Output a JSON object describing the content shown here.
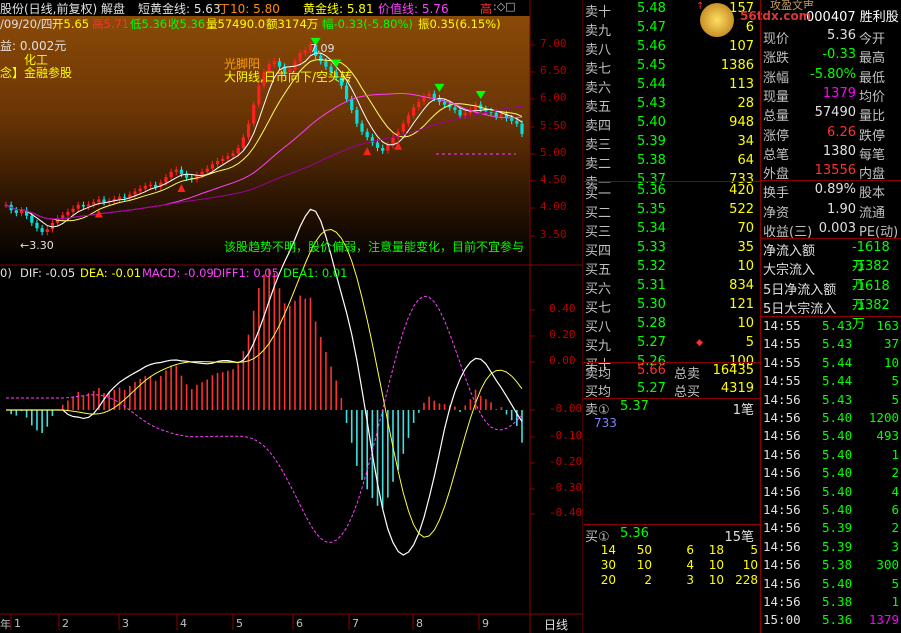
{
  "header": {
    "stock": "股份(日线,前复权) 解盘",
    "short_gold": "短黄金线: 5.63",
    "ding": "丁10: 5.80",
    "gold": "黄金线: 5.81",
    "value_line": "价值线: 5.76",
    "high_mark": "高",
    "line2_date": "/09/20/四",
    "line2_open": "开5.65",
    "line2_high": "高5.71",
    "line2_low": "低5.36",
    "line2_close": "收5.36",
    "line2_vol": "量57490.0",
    "line2_amt": "额3174万",
    "line2_chg": "幅-0.33(-5.80%)",
    "line2_amp": "振0.35(6.15%)"
  },
  "price_panel": {
    "profit": "益: 0.002元",
    "industry": "化工",
    "concept": "念】金融参股",
    "annotation1": "光脚阳",
    "annotation2": "大阴线,日市向下/空头转",
    "peak_label": "7.09",
    "low_label": "3.30",
    "advice": "该股趋势不明，股价偏弱，注意量能变化，目前不宜参与",
    "y_ticks": [
      "7.00",
      "6.50",
      "6.00",
      "5.50",
      "5.00",
      "4.50",
      "4.00",
      "3.50"
    ]
  },
  "macd_panel": {
    "title": "0)",
    "dif": "DIF: -0.05",
    "dea": "DEA: -0.01",
    "macd": "MACD: -0.09",
    "diff1": "DIFF1: 0.05",
    "dea1": "DEA1: 0.01",
    "y_ticks": [
      "0.40",
      "0.20",
      "0.00",
      "-0.00",
      "-0.10",
      "-0.20",
      "-0.30",
      "-0.40"
    ]
  },
  "date_axis": {
    "year": "年",
    "months": [
      "1",
      "2",
      "3",
      "4",
      "5",
      "6",
      "7",
      "8",
      "9"
    ],
    "period": "日线"
  },
  "order_book": {
    "asks": [
      {
        "label": "卖十",
        "price": "5.48",
        "vol": "157",
        "mark": "↑"
      },
      {
        "label": "卖九",
        "price": "5.47",
        "vol": "6"
      },
      {
        "label": "卖八",
        "price": "5.46",
        "vol": "107"
      },
      {
        "label": "卖七",
        "price": "5.45",
        "vol": "1386"
      },
      {
        "label": "卖六",
        "price": "5.44",
        "vol": "113"
      },
      {
        "label": "卖五",
        "price": "5.43",
        "vol": "28"
      },
      {
        "label": "卖四",
        "price": "5.40",
        "vol": "948"
      },
      {
        "label": "卖三",
        "price": "5.39",
        "vol": "34"
      },
      {
        "label": "卖二",
        "price": "5.38",
        "vol": "64"
      },
      {
        "label": "卖一",
        "price": "5.37",
        "vol": "733"
      }
    ],
    "bids": [
      {
        "label": "买一",
        "price": "5.36",
        "vol": "420"
      },
      {
        "label": "买二",
        "price": "5.35",
        "vol": "522"
      },
      {
        "label": "买三",
        "price": "5.34",
        "vol": "70"
      },
      {
        "label": "买四",
        "price": "5.33",
        "vol": "35"
      },
      {
        "label": "买五",
        "price": "5.32",
        "vol": "10"
      },
      {
        "label": "买六",
        "price": "5.31",
        "vol": "834"
      },
      {
        "label": "买七",
        "price": "5.30",
        "vol": "121"
      },
      {
        "label": "买八",
        "price": "5.28",
        "vol": "10"
      },
      {
        "label": "买九",
        "price": "5.27",
        "vol": "5",
        "mark": "◆"
      },
      {
        "label": "买十",
        "price": "5.26",
        "vol": "100"
      }
    ],
    "avg_sell_label": "卖均",
    "avg_sell": "5.66",
    "total_sell_label": "总卖",
    "total_sell": "16435",
    "avg_buy_label": "买均",
    "avg_buy": "5.27",
    "total_buy_label": "总买",
    "total_buy": "4319",
    "sell1_label": "卖①",
    "sell1_price": "5.37",
    "sell1_count": "1笔",
    "sell1_queue": "733",
    "buy1_label": "买①",
    "buy1_price": "5.36",
    "buy1_count": "15笔",
    "buy1_queue": [
      [
        "14",
        "50",
        "6",
        "18",
        "5"
      ],
      [
        "30",
        "10",
        "4",
        "10",
        "10"
      ],
      [
        "20",
        "2",
        "3",
        "10",
        "228"
      ]
    ]
  },
  "quote": {
    "top_badge": "攻盈文审",
    "code": "000407 胜利股",
    "watermark": "56tdx.com",
    "rows": [
      {
        "l": "现价",
        "v": "5.36",
        "r": "今开",
        "c": "#e0e0e0"
      },
      {
        "l": "涨跌",
        "v": "-0.33",
        "r": "最高",
        "c": "#00ff00"
      },
      {
        "l": "涨幅",
        "v": "-5.80%",
        "r": "最低",
        "c": "#00ff00"
      },
      {
        "l": "现量",
        "v": "1379",
        "r": "均价",
        "c": "#ff00ff"
      },
      {
        "l": "总量",
        "v": "57490",
        "r": "量比",
        "c": "#e0e0e0"
      },
      {
        "l": "涨停",
        "v": "6.26",
        "r": "跌停",
        "c": "#ff3030"
      },
      {
        "l": "总笔",
        "v": "1380",
        "r": "每笔",
        "c": "#e0e0e0"
      },
      {
        "l": "外盘",
        "v": "13556",
        "r": "内盘",
        "c": "#ff3030"
      },
      {
        "l": "换手",
        "v": "0.89%",
        "r": "股本",
        "c": "#e0e0e0"
      },
      {
        "l": "净资",
        "v": "1.90",
        "r": "流通",
        "c": "#e0e0e0"
      },
      {
        "l": "收益(三)",
        "v": "0.003",
        "r": "PE(动)",
        "c": "#e0e0e0"
      }
    ],
    "flows": [
      {
        "l": "净流入额",
        "v": "-1618万"
      },
      {
        "l": "大宗流入",
        "v": "-1382万"
      },
      {
        "l": "5日净流入额",
        "v": "-1618万"
      },
      {
        "l": "5日大宗流入",
        "v": "-1382万"
      }
    ]
  },
  "ticks": [
    {
      "t": "14:55",
      "p": "5.43",
      "v": "163",
      "c": "#00ff00"
    },
    {
      "t": "14:55",
      "p": "5.43",
      "v": "37",
      "c": "#00ff00"
    },
    {
      "t": "14:55",
      "p": "5.44",
      "v": "10",
      "c": "#00ff00"
    },
    {
      "t": "14:55",
      "p": "5.44",
      "v": "5",
      "c": "#00ff00"
    },
    {
      "t": "14:56",
      "p": "5.43",
      "v": "5",
      "c": "#00ff00"
    },
    {
      "t": "14:56",
      "p": "5.40",
      "v": "1200",
      "c": "#00ff00"
    },
    {
      "t": "14:56",
      "p": "5.40",
      "v": "493",
      "c": "#00ff00"
    },
    {
      "t": "14:56",
      "p": "5.40",
      "v": "1",
      "c": "#00ff00"
    },
    {
      "t": "14:56",
      "p": "5.40",
      "v": "2",
      "c": "#00ff00"
    },
    {
      "t": "14:56",
      "p": "5.40",
      "v": "4",
      "c": "#00ff00"
    },
    {
      "t": "14:56",
      "p": "5.40",
      "v": "6",
      "c": "#00ff00"
    },
    {
      "t": "14:56",
      "p": "5.39",
      "v": "2",
      "c": "#00ff00"
    },
    {
      "t": "14:56",
      "p": "5.39",
      "v": "3",
      "c": "#00ff00"
    },
    {
      "t": "14:56",
      "p": "5.38",
      "v": "300",
      "c": "#00ff00"
    },
    {
      "t": "14:56",
      "p": "5.40",
      "v": "5",
      "c": "#00ff00"
    },
    {
      "t": "14:56",
      "p": "5.38",
      "v": "1",
      "c": "#00ff00"
    },
    {
      "t": "15:00",
      "p": "5.36",
      "v": "1379",
      "c": "#ff00ff"
    }
  ]
}
